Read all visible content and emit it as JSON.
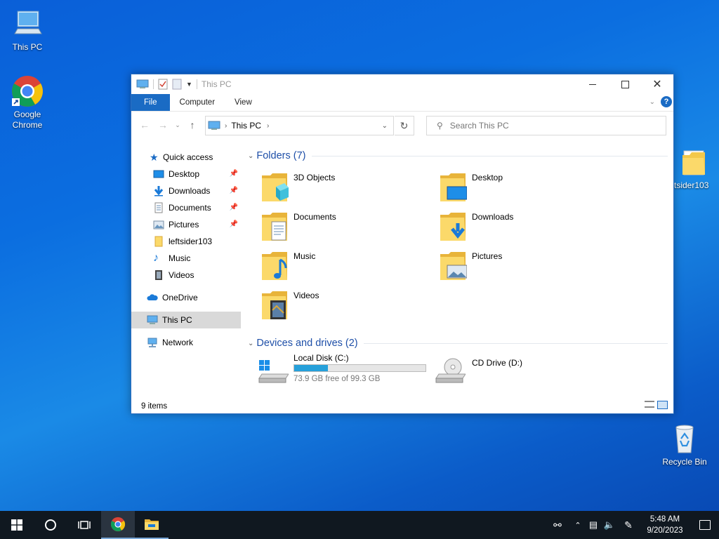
{
  "desktop": {
    "icons": [
      {
        "label": "This PC"
      },
      {
        "label": "Google Chrome"
      },
      {
        "label": "tsider103"
      },
      {
        "label": "Recycle Bin"
      }
    ]
  },
  "window": {
    "title": "This PC",
    "ribbon_tabs": [
      "File",
      "Computer",
      "View"
    ],
    "address": {
      "location": "This PC"
    },
    "search": {
      "placeholder": "Search This PC"
    },
    "sidebar": [
      {
        "label": "Quick access",
        "icon": "star-icon"
      },
      {
        "label": "Desktop",
        "icon": "desktop-icon",
        "pinned": true
      },
      {
        "label": "Downloads",
        "icon": "download-icon",
        "pinned": true
      },
      {
        "label": "Documents",
        "icon": "document-icon",
        "pinned": true
      },
      {
        "label": "Pictures",
        "icon": "picture-icon",
        "pinned": true
      },
      {
        "label": "leftsider103",
        "icon": "folder-icon"
      },
      {
        "label": "Music",
        "icon": "music-icon"
      },
      {
        "label": "Videos",
        "icon": "video-icon"
      },
      {
        "label": "OneDrive",
        "icon": "cloud-icon"
      },
      {
        "label": "This PC",
        "icon": "computer-icon",
        "selected": true
      },
      {
        "label": "Network",
        "icon": "network-icon"
      }
    ],
    "folders_header": "Folders (7)",
    "folders": [
      {
        "label": "3D Objects",
        "icon": "3d-objects-icon"
      },
      {
        "label": "Desktop",
        "icon": "desktop-folder-icon"
      },
      {
        "label": "Documents",
        "icon": "documents-folder-icon"
      },
      {
        "label": "Downloads",
        "icon": "downloads-folder-icon"
      },
      {
        "label": "Music",
        "icon": "music-folder-icon"
      },
      {
        "label": "Pictures",
        "icon": "pictures-folder-icon"
      },
      {
        "label": "Videos",
        "icon": "videos-folder-icon"
      }
    ],
    "devices_header": "Devices and drives (2)",
    "drives": [
      {
        "label": "Local Disk (C:)",
        "free_text": "73.9 GB free of 99.3 GB",
        "used_fraction": 0.256
      },
      {
        "label": "CD Drive (D:)"
      }
    ],
    "status": "9 items"
  },
  "taskbar": {
    "time": "5:48 AM",
    "date": "9/20/2023"
  },
  "colors": {
    "accent": "#1a6bc4",
    "folder_header": "#1e4fa8",
    "drive_bar": "#26a0da",
    "taskbar": "#101820"
  }
}
